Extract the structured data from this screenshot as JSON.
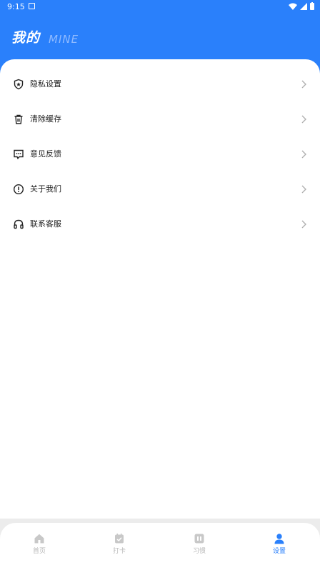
{
  "status_bar": {
    "time": "9:15"
  },
  "header": {
    "title": "我的",
    "subtitle": "MINE"
  },
  "menu": [
    {
      "label": "隐私设置",
      "icon": "shield-icon"
    },
    {
      "label": "清除缓存",
      "icon": "trash-icon"
    },
    {
      "label": "意见反馈",
      "icon": "feedback-icon"
    },
    {
      "label": "关于我们",
      "icon": "info-icon"
    },
    {
      "label": "联系客服",
      "icon": "headset-icon"
    }
  ],
  "tabs": [
    {
      "label": "首页",
      "icon": "home-icon",
      "active": false
    },
    {
      "label": "打卡",
      "icon": "checkin-icon",
      "active": false
    },
    {
      "label": "习惯",
      "icon": "habit-icon",
      "active": false
    },
    {
      "label": "设置",
      "icon": "user-icon",
      "active": true
    }
  ],
  "colors": {
    "primary": "#2a80fb",
    "inactive": "#b8b8b8",
    "text": "#222222"
  }
}
